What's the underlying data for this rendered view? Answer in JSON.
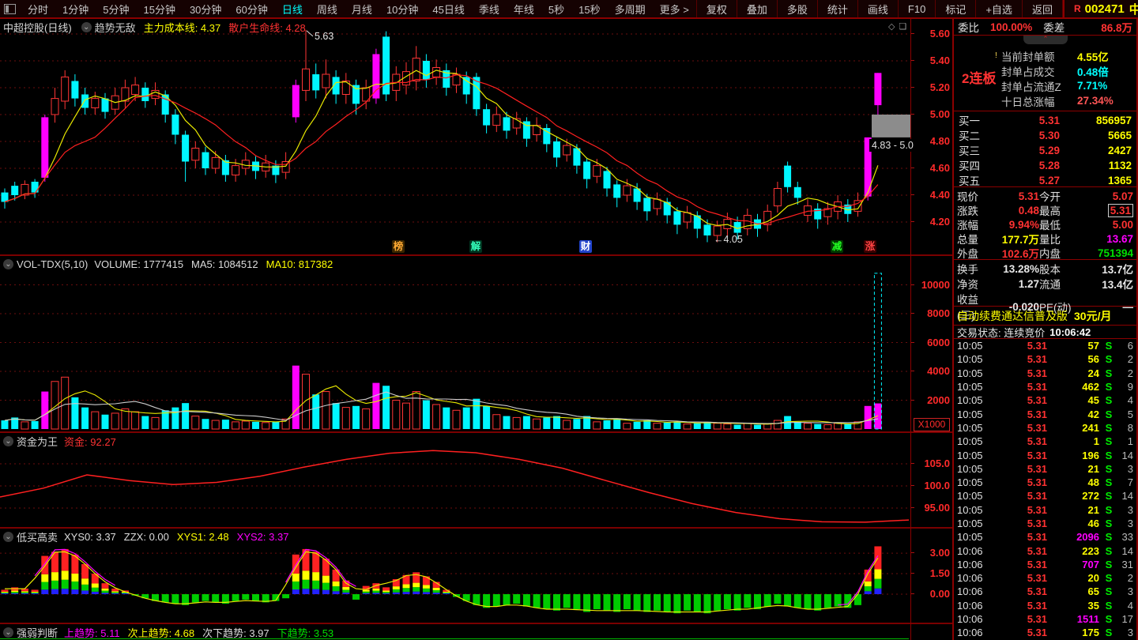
{
  "toolbar": {
    "periods": [
      "分时",
      "1分钟",
      "5分钟",
      "15分钟",
      "30分钟",
      "60分钟",
      "日线",
      "周线",
      "月线",
      "10分钟",
      "45日线",
      "季线",
      "年线",
      "5秒",
      "15秒",
      "多周期",
      "更多 >"
    ],
    "active_period": "日线",
    "buttons": [
      "复权",
      "叠加",
      "多股",
      "统计",
      "画线",
      "F10",
      "标记",
      "+自选",
      "返回"
    ],
    "stock": {
      "flag": "R",
      "code": "002471",
      "name": "中超控股"
    }
  },
  "icons": {
    "chevron_down": "⌄",
    "collapse_up": "⌃",
    "diamond": "◇",
    "panel": "❏",
    "alert": "!",
    "arrow_left": "←"
  },
  "main_panel": {
    "title": "中超控股(日线)",
    "indicator_name": "趋势无敌",
    "line_labels": [
      {
        "text": "主力成本线: 4.37",
        "color": "#ffff00"
      },
      {
        "text": "散户生命线: 4.28",
        "color": "#ff3232"
      }
    ],
    "y_ticks": [
      "5.60",
      "5.40",
      "5.20",
      "5.00",
      "4.80",
      "4.60",
      "4.40",
      "4.20"
    ],
    "annotations": {
      "high": "5.63",
      "low": "4.05",
      "gap_label": "4.83 - 5.0"
    },
    "event_markers": [
      {
        "char": "榜",
        "color": "#ffaa33",
        "bg": "#3a2600",
        "x": 496
      },
      {
        "char": "解",
        "color": "#33ffbb",
        "bg": "#00331f",
        "x": 594
      },
      {
        "char": "财",
        "color": "#ffffff",
        "bg": "#2244cc",
        "x": 733
      },
      {
        "char": "减",
        "color": "#22ff22",
        "bg": "#003a00",
        "x": 1051
      },
      {
        "char": "涨",
        "color": "#ff4444",
        "bg": "#3a0000",
        "x": 1093
      }
    ]
  },
  "volume_panel": {
    "title": "VOL-TDX(5,10)",
    "labels": [
      {
        "text": "VOLUME: 1777415",
        "color": "#dddddd"
      },
      {
        "text": "MA5: 1084512",
        "color": "#dddddd"
      },
      {
        "text": "MA10: 817382",
        "color": "#ffff00"
      }
    ],
    "y_ticks": [
      "10000",
      "8000",
      "6000",
      "4000",
      "2000"
    ],
    "unit": "X1000"
  },
  "fund_panel": {
    "title": "资金为王",
    "label": "资金:",
    "value": "92.27",
    "y_ticks": [
      "105.0",
      "100.0",
      "95.00"
    ]
  },
  "lbgs_panel": {
    "title": "低买高卖",
    "labels": [
      {
        "text": "XYS0: 3.37",
        "color": "#dddddd"
      },
      {
        "text": "ZZX: 0.00",
        "color": "#dddddd"
      },
      {
        "text": "XYS1: 2.48",
        "color": "#ffff00"
      },
      {
        "text": "XYS2: 3.37",
        "color": "#ff00ff"
      }
    ],
    "y_ticks": [
      "3.00",
      "1.50",
      "0.00"
    ]
  },
  "strength_panel": {
    "title": "强弱判断",
    "labels": [
      {
        "text": "上趋势: 5.11",
        "color": "#ff00ff"
      },
      {
        "text": "次上趋势: 4.68",
        "color": "#ffff00"
      },
      {
        "text": "次下趋势: 3.97",
        "color": "#dddddd"
      },
      {
        "text": "下趋势: 3.53",
        "color": "#00e000"
      }
    ]
  },
  "sidebar": {
    "weibi_label": "委比",
    "weibi_value": "100.00%",
    "weicha_label": "委差",
    "weicha_value": "86.8万",
    "lianban": "2连板",
    "stats": [
      {
        "label": "当前封单额",
        "value": "4.55亿",
        "color": "#ffff00"
      },
      {
        "label": "封单占成交",
        "value": "0.48倍",
        "color": "#00ffff"
      },
      {
        "label": "封单占流通Z",
        "value": "7.71%",
        "color": "#00ffff"
      },
      {
        "label": "十日总涨幅",
        "value": "27.34%",
        "color": "#ff5555"
      }
    ],
    "buy_orders": [
      {
        "label": "买一",
        "price": "5.31",
        "volume": "856957"
      },
      {
        "label": "买二",
        "price": "5.30",
        "volume": "5665"
      },
      {
        "label": "买三",
        "price": "5.29",
        "volume": "2427"
      },
      {
        "label": "买四",
        "price": "5.28",
        "volume": "1132"
      },
      {
        "label": "买五",
        "price": "5.27",
        "volume": "1365"
      }
    ],
    "quote": [
      {
        "l1": "现价",
        "v1": "5.31",
        "c1": "#ff3232",
        "l2": "今开",
        "v2": "5.07",
        "c2": "#ff3232",
        "boxed": false
      },
      {
        "l1": "涨跌",
        "v1": "0.48",
        "c1": "#ff3232",
        "l2": "最高",
        "v2": "5.31",
        "c2": "#ff3232",
        "boxed": true
      },
      {
        "l1": "涨幅",
        "v1": "9.94%",
        "c1": "#ff3232",
        "l2": "最低",
        "v2": "5.00",
        "c2": "#ff3232",
        "boxed": false
      },
      {
        "l1": "总量",
        "v1": "177.7万",
        "c1": "#ffff00",
        "l2": "量比",
        "v2": "13.67",
        "c2": "#ff00ff",
        "boxed": false
      },
      {
        "l1": "外盘",
        "v1": "102.6万",
        "c1": "#ff3232",
        "l2": "内盘",
        "v2": "751394",
        "c2": "#00e000",
        "boxed": false
      }
    ],
    "info": [
      {
        "l1": "换手",
        "v1": "13.28%",
        "l2": "股本",
        "v2": "13.7亿"
      },
      {
        "l1": "净资",
        "v1": "1.27",
        "l2": "流通",
        "v2": "13.4亿"
      },
      {
        "l1": "收益(三)",
        "v1": "-0.020",
        "l2": "PE(动)",
        "v2": "—"
      }
    ],
    "banner": {
      "text": "自动续费通达信普及版",
      "price": "30元/月"
    },
    "status": {
      "label": "交易状态: 连续竞价",
      "time": "10:06:42"
    },
    "ticks": [
      {
        "t": "10:05",
        "p": "5.31",
        "v": "57",
        "s": "S",
        "n": "6"
      },
      {
        "t": "10:05",
        "p": "5.31",
        "v": "56",
        "s": "S",
        "n": "2"
      },
      {
        "t": "10:05",
        "p": "5.31",
        "v": "24",
        "s": "S",
        "n": "2"
      },
      {
        "t": "10:05",
        "p": "5.31",
        "v": "462",
        "s": "S",
        "n": "9"
      },
      {
        "t": "10:05",
        "p": "5.31",
        "v": "45",
        "s": "S",
        "n": "4"
      },
      {
        "t": "10:05",
        "p": "5.31",
        "v": "42",
        "s": "S",
        "n": "5"
      },
      {
        "t": "10:05",
        "p": "5.31",
        "v": "241",
        "s": "S",
        "n": "8"
      },
      {
        "t": "10:05",
        "p": "5.31",
        "v": "1",
        "s": "S",
        "n": "1"
      },
      {
        "t": "10:05",
        "p": "5.31",
        "v": "196",
        "s": "S",
        "n": "14"
      },
      {
        "t": "10:05",
        "p": "5.31",
        "v": "21",
        "s": "S",
        "n": "3"
      },
      {
        "t": "10:05",
        "p": "5.31",
        "v": "48",
        "s": "S",
        "n": "7"
      },
      {
        "t": "10:05",
        "p": "5.31",
        "v": "272",
        "s": "S",
        "n": "14"
      },
      {
        "t": "10:05",
        "p": "5.31",
        "v": "21",
        "s": "S",
        "n": "3"
      },
      {
        "t": "10:05",
        "p": "5.31",
        "v": "46",
        "s": "S",
        "n": "3"
      },
      {
        "t": "10:05",
        "p": "5.31",
        "v": "2096",
        "s": "S",
        "n": "33"
      },
      {
        "t": "10:06",
        "p": "5.31",
        "v": "223",
        "s": "S",
        "n": "14"
      },
      {
        "t": "10:06",
        "p": "5.31",
        "v": "707",
        "s": "S",
        "n": "31"
      },
      {
        "t": "10:06",
        "p": "5.31",
        "v": "20",
        "s": "S",
        "n": "2"
      },
      {
        "t": "10:06",
        "p": "5.31",
        "v": "65",
        "s": "S",
        "n": "3"
      },
      {
        "t": "10:06",
        "p": "5.31",
        "v": "35",
        "s": "S",
        "n": "4"
      },
      {
        "t": "10:06",
        "p": "5.31",
        "v": "1511",
        "s": "S",
        "n": "17"
      },
      {
        "t": "10:06",
        "p": "5.31",
        "v": "175",
        "s": "S",
        "n": "3"
      }
    ]
  },
  "chart_data": {
    "type": "candlestick",
    "title": "中超控股 日线",
    "price_ticks": [
      5.6,
      5.4,
      5.2,
      5.0,
      4.8,
      4.6,
      4.4,
      4.2
    ],
    "volume_ticks": [
      10000,
      8000,
      6000,
      4000,
      2000
    ],
    "fund_ticks": [
      105.0,
      100.0,
      95.0
    ],
    "lbgs_ticks": [
      3.0,
      1.5,
      0.0
    ],
    "colors": {
      "up": "#ff3535",
      "down": "#00f6ff",
      "limit": "#ff00ff",
      "ma_fast": "#e8e800",
      "ma_slow": "#ff2020",
      "gap_box": "#8c8c8c"
    },
    "high_point": 5.63,
    "low_point": 4.05,
    "gap_zone": [
      4.83,
      5.0
    ],
    "candles": [
      [
        4.42,
        4.35,
        4.3,
        4.45,
        "c"
      ],
      [
        4.47,
        4.4,
        4.36,
        4.5,
        "c"
      ],
      [
        4.4,
        4.48,
        4.37,
        4.51,
        "r"
      ],
      [
        4.5,
        4.42,
        4.38,
        4.52,
        "c"
      ],
      [
        4.53,
        4.98,
        4.5,
        5.0,
        "m"
      ],
      [
        5.0,
        5.12,
        4.94,
        5.2,
        "r"
      ],
      [
        5.1,
        5.28,
        5.04,
        5.33,
        "r"
      ],
      [
        5.25,
        5.12,
        5.06,
        5.3,
        "c"
      ],
      [
        5.15,
        5.05,
        5.0,
        5.2,
        "c"
      ],
      [
        5.05,
        5.12,
        5.0,
        5.17,
        "r"
      ],
      [
        5.12,
        5.02,
        4.97,
        5.16,
        "c"
      ],
      [
        5.04,
        5.14,
        5.0,
        5.2,
        "r"
      ],
      [
        5.1,
        5.2,
        5.05,
        5.26,
        "r"
      ],
      [
        5.15,
        5.22,
        5.1,
        5.28,
        "r"
      ],
      [
        5.2,
        5.1,
        5.05,
        5.24,
        "c"
      ],
      [
        5.12,
        5.18,
        5.07,
        5.24,
        "r"
      ],
      [
        5.15,
        5.0,
        4.94,
        5.18,
        "c"
      ],
      [
        5.0,
        4.85,
        4.78,
        5.04,
        "c"
      ],
      [
        4.85,
        4.65,
        4.5,
        4.88,
        "c"
      ],
      [
        4.66,
        4.75,
        4.6,
        4.8,
        "r"
      ],
      [
        4.72,
        4.6,
        4.55,
        4.76,
        "c"
      ],
      [
        4.6,
        4.68,
        4.56,
        4.73,
        "r"
      ],
      [
        4.66,
        4.55,
        4.5,
        4.7,
        "c"
      ],
      [
        4.55,
        4.62,
        4.5,
        4.67,
        "r"
      ],
      [
        4.6,
        4.66,
        4.55,
        4.72,
        "r"
      ],
      [
        4.65,
        4.58,
        4.52,
        4.69,
        "c"
      ],
      [
        4.58,
        4.64,
        4.53,
        4.7,
        "r"
      ],
      [
        4.62,
        4.55,
        4.49,
        4.66,
        "c"
      ],
      [
        4.57,
        4.65,
        4.52,
        4.72,
        "r"
      ],
      [
        4.98,
        5.22,
        4.94,
        5.26,
        "m"
      ],
      [
        5.18,
        5.34,
        5.1,
        5.63,
        "r"
      ],
      [
        5.3,
        5.18,
        5.12,
        5.38,
        "c"
      ],
      [
        5.2,
        5.3,
        5.12,
        5.41,
        "r"
      ],
      [
        5.28,
        5.15,
        5.08,
        5.33,
        "c"
      ],
      [
        5.15,
        5.25,
        5.08,
        5.31,
        "r"
      ],
      [
        5.22,
        5.08,
        5.0,
        5.26,
        "c"
      ],
      [
        5.1,
        5.2,
        5.04,
        5.26,
        "r"
      ],
      [
        5.12,
        5.45,
        5.08,
        5.49,
        "m"
      ],
      [
        5.58,
        5.15,
        5.1,
        5.62,
        "c"
      ],
      [
        5.18,
        5.3,
        5.1,
        5.36,
        "r"
      ],
      [
        5.22,
        5.32,
        5.15,
        5.39,
        "r"
      ],
      [
        5.25,
        5.42,
        5.18,
        5.51,
        "r"
      ],
      [
        5.4,
        5.26,
        5.2,
        5.45,
        "c"
      ],
      [
        5.28,
        5.35,
        5.22,
        5.41,
        "r"
      ],
      [
        5.33,
        5.2,
        5.14,
        5.38,
        "c"
      ],
      [
        5.22,
        5.3,
        5.16,
        5.35,
        "r"
      ],
      [
        5.28,
        5.15,
        5.08,
        5.32,
        "c"
      ],
      [
        5.28,
        5.04,
        4.99,
        5.31,
        "c"
      ],
      [
        5.04,
        4.92,
        4.86,
        5.08,
        "c"
      ],
      [
        4.92,
        5.0,
        4.87,
        5.06,
        "r"
      ],
      [
        4.98,
        4.88,
        4.82,
        5.02,
        "c"
      ],
      [
        4.9,
        4.97,
        4.85,
        5.02,
        "r"
      ],
      [
        4.95,
        4.82,
        4.76,
        4.98,
        "c"
      ],
      [
        4.85,
        4.92,
        4.8,
        4.98,
        "r"
      ],
      [
        4.9,
        4.78,
        4.72,
        4.93,
        "c"
      ],
      [
        4.8,
        4.68,
        4.61,
        4.83,
        "c"
      ],
      [
        4.7,
        4.77,
        4.65,
        4.82,
        "r"
      ],
      [
        4.75,
        4.62,
        4.56,
        4.78,
        "c"
      ],
      [
        4.65,
        4.52,
        4.45,
        4.68,
        "c"
      ],
      [
        4.54,
        4.62,
        4.49,
        4.67,
        "r"
      ],
      [
        4.58,
        4.45,
        4.39,
        4.61,
        "c"
      ],
      [
        4.48,
        4.38,
        4.31,
        4.51,
        "c"
      ],
      [
        4.4,
        4.47,
        4.35,
        4.52,
        "r"
      ],
      [
        4.45,
        4.35,
        4.29,
        4.49,
        "c"
      ],
      [
        4.38,
        4.28,
        4.21,
        4.41,
        "c"
      ],
      [
        4.3,
        4.37,
        4.25,
        4.42,
        "r"
      ],
      [
        4.35,
        4.25,
        4.19,
        4.38,
        "c"
      ],
      [
        4.28,
        4.18,
        4.11,
        4.31,
        "c"
      ],
      [
        4.2,
        4.27,
        4.15,
        4.32,
        "r"
      ],
      [
        4.25,
        4.15,
        4.08,
        4.28,
        "c"
      ],
      [
        4.18,
        4.1,
        4.05,
        4.22,
        "c"
      ],
      [
        4.1,
        4.17,
        4.05,
        4.21,
        "r"
      ],
      [
        4.15,
        4.22,
        4.1,
        4.27,
        "r"
      ],
      [
        4.2,
        4.12,
        4.07,
        4.24,
        "c"
      ],
      [
        4.15,
        4.25,
        4.1,
        4.3,
        "r"
      ],
      [
        4.22,
        4.15,
        4.09,
        4.26,
        "c"
      ],
      [
        4.18,
        4.28,
        4.13,
        4.33,
        "r"
      ],
      [
        4.32,
        4.45,
        4.27,
        4.5,
        "r"
      ],
      [
        4.62,
        4.46,
        4.42,
        4.65,
        "c"
      ],
      [
        4.46,
        4.38,
        4.33,
        4.5,
        "c"
      ],
      [
        4.25,
        4.32,
        4.2,
        4.37,
        "r"
      ],
      [
        4.3,
        4.22,
        4.15,
        4.34,
        "c"
      ],
      [
        4.24,
        4.3,
        4.18,
        4.35,
        "r"
      ],
      [
        4.28,
        4.35,
        4.22,
        4.4,
        "r"
      ],
      [
        4.33,
        4.26,
        4.2,
        4.37,
        "c"
      ],
      [
        4.28,
        4.36,
        4.24,
        4.42,
        "r"
      ],
      [
        4.39,
        4.83,
        4.36,
        4.83,
        "m"
      ],
      [
        5.07,
        5.31,
        5.0,
        5.31,
        "m"
      ]
    ],
    "volumes": [
      600,
      800,
      500,
      550,
      2600,
      3300,
      3600,
      2200,
      1500,
      1200,
      1000,
      1100,
      1400,
      1200,
      900,
      800,
      1300,
      1500,
      1800,
      900,
      700,
      600,
      650,
      500,
      550,
      500,
      450,
      500,
      700,
      4400,
      3800,
      2400,
      2600,
      1800,
      1500,
      1600,
      1400,
      3200,
      3000,
      2000,
      1800,
      2600,
      2000,
      1700,
      1500,
      1300,
      1500,
      2100,
      1600,
      1000,
      900,
      800,
      900,
      700,
      800,
      900,
      600,
      700,
      900,
      500,
      600,
      700,
      400,
      500,
      600,
      400,
      450,
      500,
      350,
      400,
      500,
      400,
      350,
      300,
      400,
      300,
      350,
      600,
      900,
      500,
      400,
      350,
      300,
      400,
      350,
      500,
      1600,
      1777
    ],
    "volume_projected": 10800,
    "fund_curve": [
      97.5,
      99.5,
      102.5,
      101.2,
      100.3,
      100.8,
      102.2,
      104.2,
      106.0,
      107.4,
      108.0,
      107.5,
      106.0,
      104.0,
      101.2,
      98.5,
      96.0,
      94.0,
      92.6,
      91.9,
      91.8,
      92.3
    ],
    "lbgs_values": [
      0.3,
      0.5,
      0.4,
      0.3,
      2.8,
      3.1,
      3.3,
      2.9,
      2.2,
      1.5,
      0.8,
      0.4,
      0.2,
      -0.1,
      -0.3,
      -0.5,
      -0.6,
      -0.7,
      -0.8,
      -0.6,
      -0.5,
      -0.6,
      -0.7,
      -0.5,
      -0.4,
      -0.5,
      -0.6,
      -0.5,
      -0.3,
      2.9,
      3.3,
      3.1,
      2.6,
      1.8,
      1.0,
      -0.4,
      0.6,
      0.8,
      0.5,
      1.1,
      1.4,
      1.6,
      1.3,
      0.9,
      0.3,
      -0.2,
      -0.5,
      -0.8,
      -1.0,
      -0.9,
      -0.8,
      -0.7,
      -0.9,
      -1.0,
      -1.1,
      -1.2,
      -1.0,
      -1.1,
      -1.3,
      -1.1,
      -1.2,
      -1.3,
      -1.1,
      -1.2,
      -1.3,
      -1.2,
      -1.3,
      -1.4,
      -1.2,
      -1.3,
      -1.4,
      -1.2,
      -1.1,
      -1.2,
      -1.0,
      -1.1,
      -0.9,
      -0.7,
      -0.9,
      -1.0,
      -1.1,
      -1.2,
      -1.0,
      -0.9,
      -1.0,
      -0.8,
      1.8,
      3.5
    ]
  }
}
